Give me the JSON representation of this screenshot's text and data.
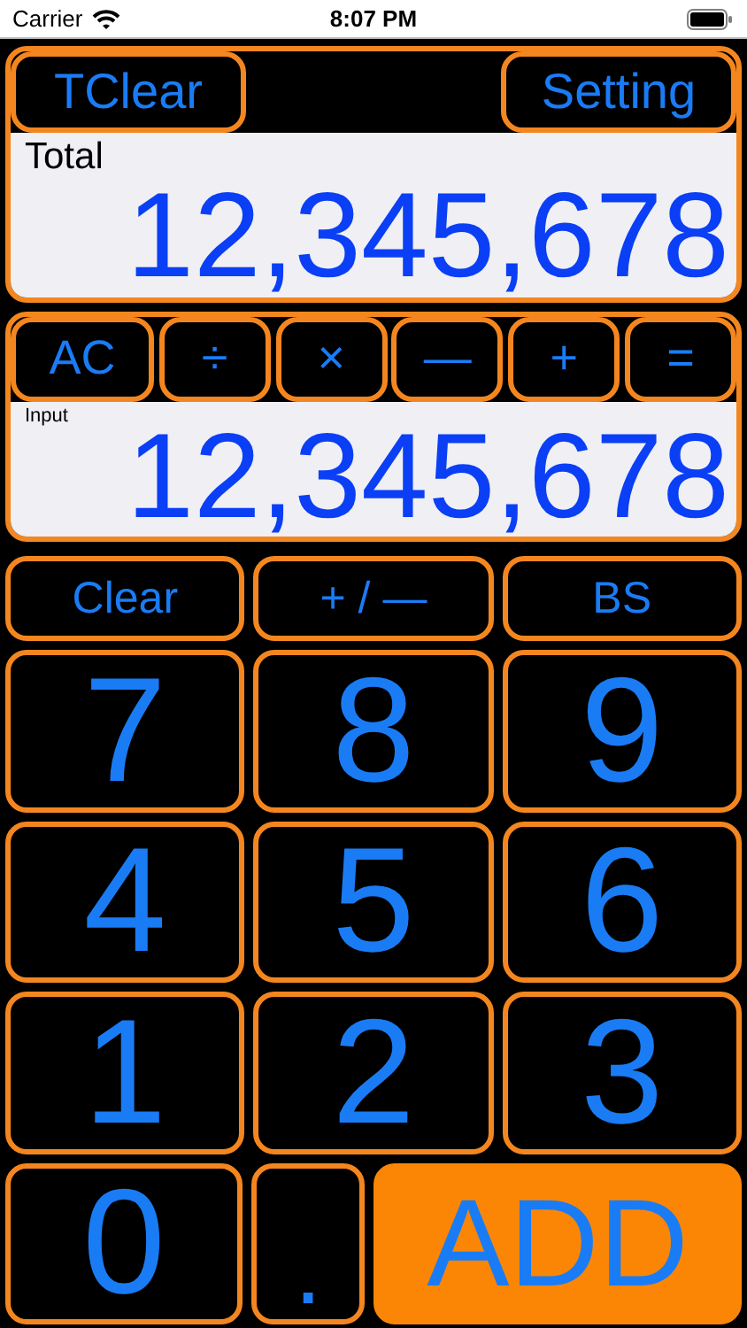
{
  "status_bar": {
    "carrier": "Carrier",
    "time": "8:07 PM"
  },
  "total_panel": {
    "left_button": "TClear",
    "right_button": "Setting",
    "label": "Total",
    "value": "12,345,678"
  },
  "operator_panel": {
    "operators": [
      "AC",
      "÷",
      "×",
      "—",
      "+",
      "="
    ],
    "label": "Input",
    "value": "12,345,678"
  },
  "edit_keys": [
    "Clear",
    "+ / —",
    "BS"
  ],
  "keypad": [
    [
      {
        "label": "7",
        "kind": "digit"
      },
      {
        "label": "8",
        "kind": "digit"
      },
      {
        "label": "9",
        "kind": "digit"
      }
    ],
    [
      {
        "label": "4",
        "kind": "digit"
      },
      {
        "label": "5",
        "kind": "digit"
      },
      {
        "label": "6",
        "kind": "digit"
      }
    ],
    [
      {
        "label": "1",
        "kind": "digit"
      },
      {
        "label": "2",
        "kind": "digit"
      },
      {
        "label": "3",
        "kind": "digit"
      }
    ],
    [
      {
        "label": "0",
        "kind": "digit"
      },
      {
        "label": ".",
        "kind": "point"
      },
      {
        "label": "ADD",
        "kind": "add"
      }
    ]
  ]
}
